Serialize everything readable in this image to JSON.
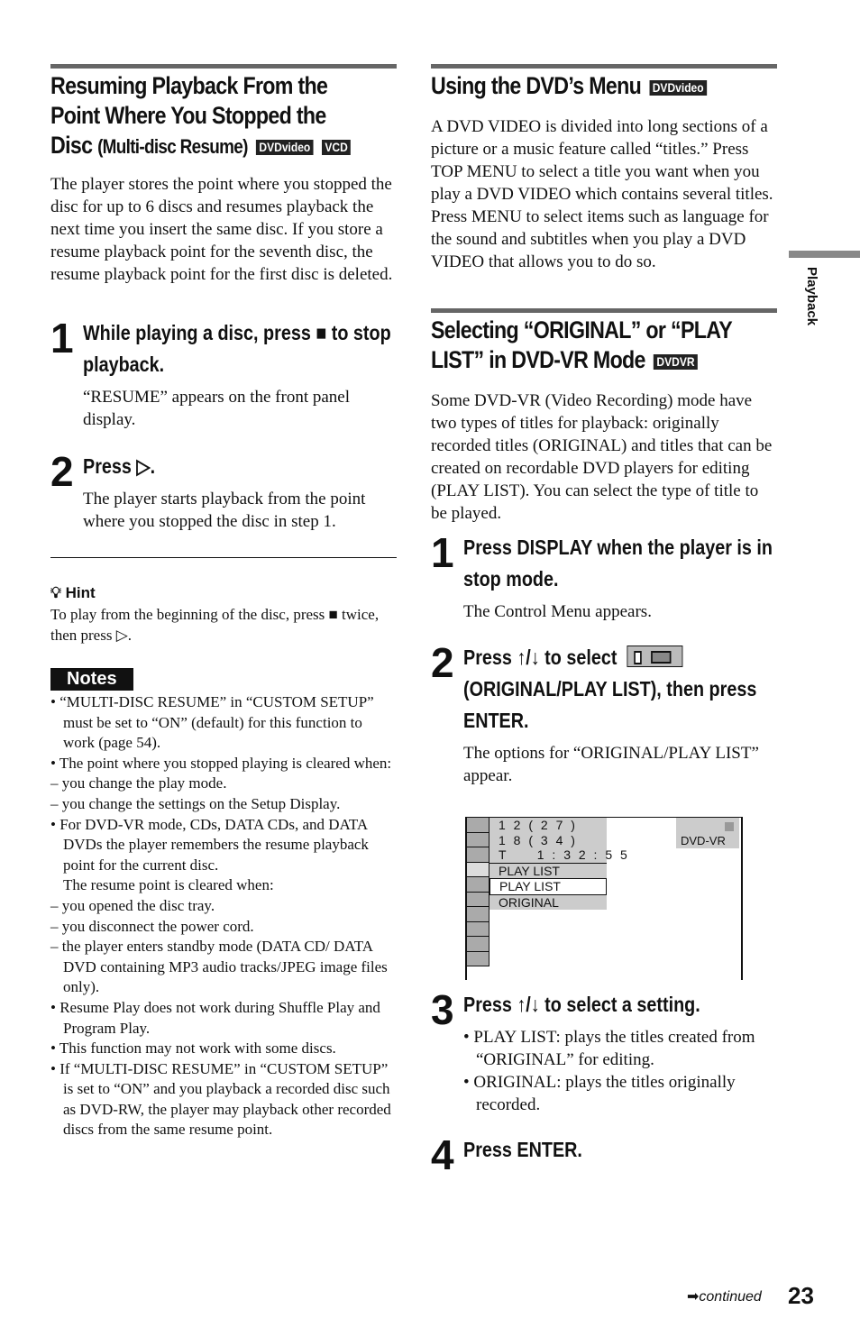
{
  "left": {
    "heading": {
      "line1": "Resuming Playback From the",
      "line2": "Point Where You Stopped the",
      "line3a": "Disc",
      "line3b": "(Multi-disc Resume)",
      "badges": [
        "DVDvideo",
        "VCD"
      ]
    },
    "intro": "The player stores the point where you stopped the disc for up to 6 discs and resumes playback the next time you insert the same disc. If you store a resume playback point for the seventh disc, the resume playback point for the first disc is deleted.",
    "steps": [
      {
        "num": "1",
        "title": "While playing a disc, press ■ to stop playback.",
        "body": "“RESUME” appears on the front panel display."
      },
      {
        "num": "2",
        "title": "Press ▷.",
        "body": "The player starts playback from the point where you stopped the disc in step 1."
      }
    ],
    "hint": {
      "label": "Hint",
      "text": "To play from the beginning of the disc, press ■ twice, then press ▷."
    },
    "notes": {
      "label": "Notes",
      "items": [
        "• “MULTI-DISC RESUME” in “CUSTOM SETUP” must be set to “ON” (default) for this function to work (page 54).",
        "• The point where you stopped playing is cleared when:",
        "– you change the play mode.",
        "– you change the settings on the Setup Display.",
        "• For DVD-VR mode, CDs, DATA CDs, and DATA DVDs the player remembers the resume playback point for the current disc.",
        "The resume point is cleared when:",
        "– you opened the disc tray.",
        "– you disconnect the power cord.",
        "– the player enters standby mode (DATA CD/ DATA DVD containing MP3 audio tracks/JPEG image files only).",
        "• Resume Play does not work during Shuffle Play and Program Play.",
        "• This function may not work with some discs.",
        "• If “MULTI-DISC RESUME” in “CUSTOM SETUP” is set to “ON” and you playback a recorded disc such as DVD-RW, the player may playback other recorded discs from the same resume point."
      ]
    }
  },
  "right": {
    "menu_section": {
      "heading": "Using the DVD’s Menu",
      "badge": "DVDvideo",
      "p1": "A DVD VIDEO is divided into long sections of a picture or a music feature called “titles.” Press TOP MENU to select a title you want when you play a DVD VIDEO which contains several titles.",
      "p2": "Press MENU to select items such as language for the sound and subtitles when you play a DVD VIDEO that allows you to do so."
    },
    "select_section": {
      "heading1": "Selecting “ORIGINAL” or “PLAY",
      "heading2": "LIST” in DVD-VR Mode",
      "badge": "DVDVR",
      "intro": "Some DVD-VR (Video Recording) mode have two types of titles for playback: originally recorded titles (ORIGINAL) and titles that can be created on recordable DVD players for editing (PLAY LIST). You can select the type of title to be played."
    },
    "steps": [
      {
        "num": "1",
        "title": "Press DISPLAY when the player is in stop mode.",
        "body": "The Control Menu appears."
      },
      {
        "num": "2",
        "title_a": "Press ↑/↓ to select",
        "title_b": "(ORIGINAL/PLAY LIST), then press ENTER.",
        "body": "The options for “ORIGINAL/PLAY LIST” appear."
      },
      {
        "num": "3",
        "title": "Press ↑/↓ to select a setting.",
        "bullets": [
          "• PLAY LIST: plays the titles created from “ORIGINAL” for editing.",
          "• ORIGINAL: plays the titles originally recorded."
        ]
      },
      {
        "num": "4",
        "title": "Press ENTER."
      }
    ],
    "control_menu": {
      "rows": [
        "1 2 ( 2 7 )",
        "1 8 ( 3 4 )",
        "T     1 : 3 2 : 5 5",
        "PLAY LIST",
        "PLAY LIST",
        "ORIGINAL"
      ],
      "mode": "DVD-VR"
    }
  },
  "side_tab": "Playback",
  "footer": {
    "continued": "continued",
    "page": "23"
  }
}
